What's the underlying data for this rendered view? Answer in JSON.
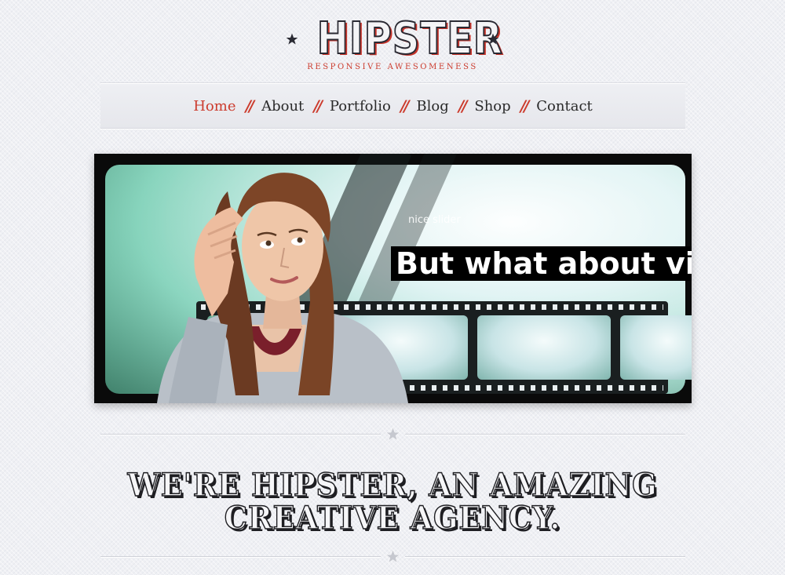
{
  "logo": {
    "title": "HIPSTER",
    "tagline": "Responsive Awesomeness"
  },
  "nav": {
    "items": [
      {
        "label": "Home",
        "active": true
      },
      {
        "label": "About"
      },
      {
        "label": "Portfolio"
      },
      {
        "label": "Blog"
      },
      {
        "label": "Shop"
      },
      {
        "label": "Contact"
      }
    ],
    "separator": "//"
  },
  "slider": {
    "small_caption": "nice slider",
    "headline": "But what about video?"
  },
  "hero": {
    "line1": "WE'RE HIPSTER, AN AMAZING",
    "line2": "CREATIVE AGENCY."
  },
  "colors": {
    "accent": "#cc3b2d",
    "text": "#2a2a2a",
    "background": "#eff0f4"
  },
  "icons": {
    "logo_star": "star-icon",
    "divider_star": "star-icon"
  }
}
